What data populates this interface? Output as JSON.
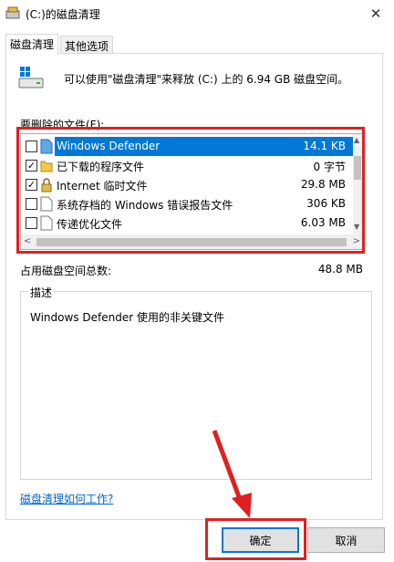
{
  "window": {
    "title": "(C:)的磁盘清理",
    "close_glyph": "✕"
  },
  "tabs": [
    {
      "label": "磁盘清理",
      "active": true
    },
    {
      "label": "其他选项",
      "active": false
    }
  ],
  "summary": "可以使用\"磁盘清理\"来释放 (C:) 上的 6.94 GB 磁盘空间。",
  "files_label": "要删除的文件(F):",
  "files": [
    {
      "name": "Windows Defender",
      "size": "14.1 KB",
      "checked": false,
      "selected": true,
      "icon": "document-blue-icon"
    },
    {
      "name": "已下载的程序文件",
      "size": "0 字节",
      "checked": true,
      "selected": false,
      "icon": "folder-icon"
    },
    {
      "name": "Internet 临时文件",
      "size": "29.8 MB",
      "checked": true,
      "selected": false,
      "icon": "lock-icon"
    },
    {
      "name": "系统存档的 Windows 错误报告文件",
      "size": "306 KB",
      "checked": false,
      "selected": false,
      "icon": "document-icon"
    },
    {
      "name": "传递优化文件",
      "size": "6.03 MB",
      "checked": false,
      "selected": false,
      "icon": "document-icon"
    }
  ],
  "checkmark": "✓",
  "total": {
    "label": "占用磁盘空间总数:",
    "value": "48.8 MB"
  },
  "description": {
    "legend": "描述",
    "text": "Windows Defender 使用的非关键文件"
  },
  "help_link": "磁盘清理如何工作?",
  "buttons": {
    "ok": "确定",
    "cancel": "取消"
  },
  "colors": {
    "selection": "#0078d7",
    "highlight": "#e02020",
    "link": "#0066cc"
  }
}
